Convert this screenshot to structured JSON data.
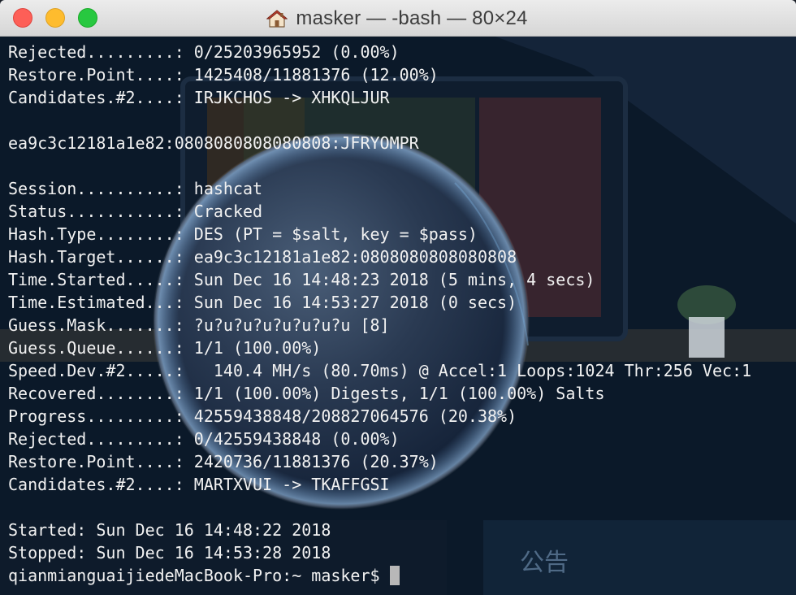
{
  "window": {
    "title": "masker — -bash — 80×24",
    "title_icon": "home-icon"
  },
  "wallpaper": {
    "notice_text": "公告"
  },
  "terminal": {
    "lines": [
      "Rejected.........: 0/25203965952 (0.00%)",
      "Restore.Point....: 1425408/11881376 (12.00%)",
      "Candidates.#2....: IRJKCHOS -> XHKQLJUR",
      "",
      "ea9c3c12181a1e82:0808080808080808:JFRYOMPR",
      "",
      "Session..........: hashcat",
      "Status...........: Cracked",
      "Hash.Type........: DES (PT = $salt, key = $pass)",
      "Hash.Target......: ea9c3c12181a1e82:0808080808080808",
      "Time.Started.....: Sun Dec 16 14:48:23 2018 (5 mins, 4 secs)",
      "Time.Estimated...: Sun Dec 16 14:53:27 2018 (0 secs)",
      "Guess.Mask.......: ?u?u?u?u?u?u?u?u [8]",
      "Guess.Queue......: 1/1 (100.00%)",
      "Speed.Dev.#2.....:   140.4 MH/s (80.70ms) @ Accel:1 Loops:1024 Thr:256 Vec:1",
      "Recovered........: 1/1 (100.00%) Digests, 1/1 (100.00%) Salts",
      "Progress.........: 42559438848/208827064576 (20.38%)",
      "Rejected.........: 0/42559438848 (0.00%)",
      "Restore.Point....: 2420736/11881376 (20.37%)",
      "Candidates.#2....: MARTXVUI -> TKAFFGSI",
      "",
      "Started: Sun Dec 16 14:48:22 2018",
      "Stopped: Sun Dec 16 14:53:28 2018"
    ],
    "prompt": "qianmianguaijiedeMacBook-Pro:~ masker$"
  },
  "colors": {
    "terminal_text": "#f2f2f2",
    "close": "#fd5f57",
    "minimize": "#febc2e",
    "maximize": "#28c840"
  }
}
